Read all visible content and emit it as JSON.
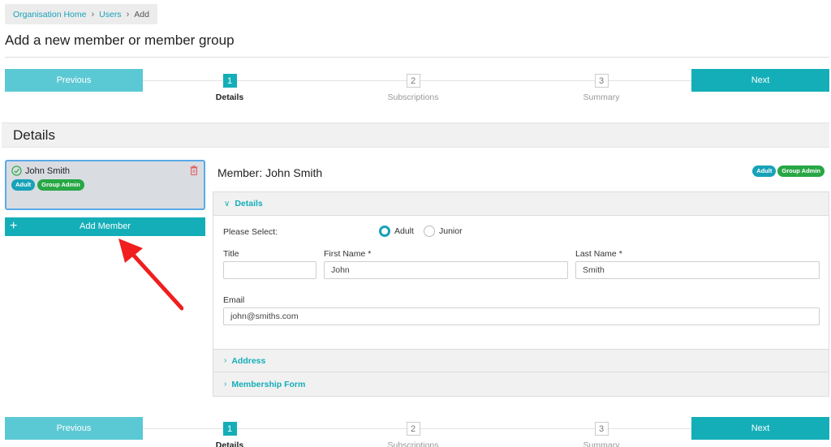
{
  "breadcrumb": {
    "home": "Organisation Home",
    "users": "Users",
    "current": "Add"
  },
  "page_title": "Add a new member or member group",
  "wizard": {
    "previous_label": "Previous",
    "next_label": "Next",
    "steps": [
      {
        "num": "1",
        "label": "Details",
        "active": true
      },
      {
        "num": "2",
        "label": "Subscriptions",
        "active": false
      },
      {
        "num": "3",
        "label": "Summary",
        "active": false
      }
    ]
  },
  "section_title": "Details",
  "member_card": {
    "name": "John Smith",
    "badges": [
      "Adult",
      "Group Admin"
    ]
  },
  "add_member_label": "Add Member",
  "member_heading": "Member: John Smith",
  "right_badges": [
    "Adult",
    "Group Admin"
  ],
  "accordion": {
    "details": "Details",
    "address": "Address",
    "membership_form": "Membership Form"
  },
  "form": {
    "please_select_label": "Please Select:",
    "radio_adult": "Adult",
    "radio_junior": "Junior",
    "title_label": "Title",
    "title_value": "",
    "first_name_label": "First Name *",
    "first_name_value": "John",
    "last_name_label": "Last Name *",
    "last_name_value": "Smith",
    "email_label": "Email",
    "email_value": "john@smiths.com"
  },
  "colors": {
    "accent": "#14aeb8",
    "badge_adult": "#17a2b8",
    "badge_group_admin": "#28a745",
    "arrow": "#f01e1e"
  }
}
